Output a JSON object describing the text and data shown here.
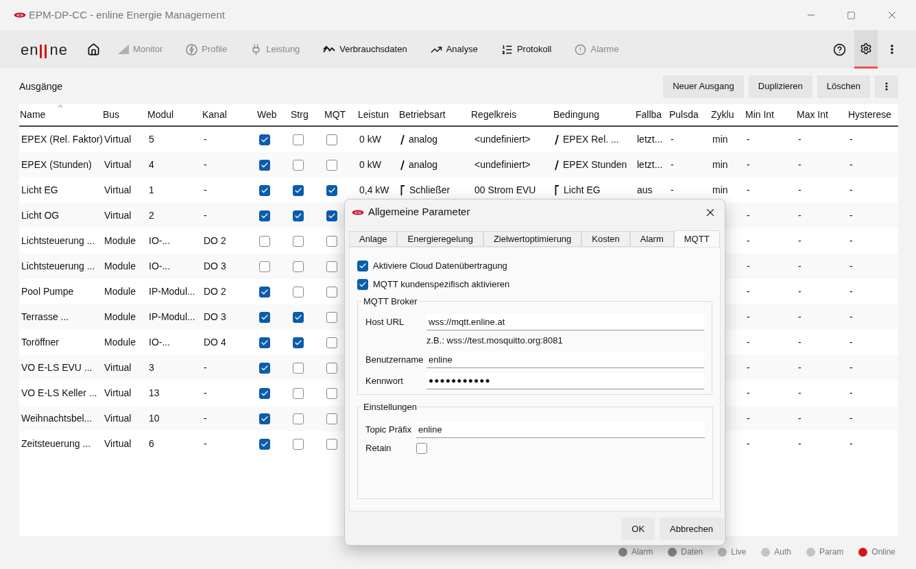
{
  "window": {
    "title": "EPM-DP-CC - enline Energie Management"
  },
  "logo": {
    "left": "en",
    "right": "ne"
  },
  "nav": [
    {
      "label": "Monitor",
      "disabled": true
    },
    {
      "label": "Profile",
      "disabled": true
    },
    {
      "label": "Leistung",
      "disabled": true
    },
    {
      "label": "Verbrauchsdaten",
      "disabled": false
    },
    {
      "label": "Analyse",
      "disabled": false
    },
    {
      "label": "Protokoll",
      "disabled": false
    },
    {
      "label": "Alarme",
      "disabled": true
    }
  ],
  "settings_active": true,
  "page": {
    "title": "Ausgänge",
    "buttons": [
      "Neuer Ausgang",
      "Duplizieren",
      "Löschen"
    ]
  },
  "table": {
    "columns": [
      {
        "label": "Name",
        "sorted": true
      },
      {
        "label": "Bus",
        "sorted": false
      },
      {
        "label": "Modul",
        "sorted": false
      },
      {
        "label": "Kanal",
        "sorted": false
      },
      {
        "label": "Web",
        "sorted": false
      },
      {
        "label": "Strg",
        "sorted": false
      },
      {
        "label": "MQT",
        "sorted": false
      },
      {
        "label": "Leistun",
        "sorted": false
      },
      {
        "label": "Betriebsart",
        "sorted": false
      },
      {
        "label": "Regelkreis",
        "sorted": false
      },
      {
        "label": "Bedingung",
        "sorted": false
      },
      {
        "label": "Fallba",
        "sorted": false
      },
      {
        "label": "Pulsda",
        "sorted": false
      },
      {
        "label": "Zyklu",
        "sorted": false
      },
      {
        "label": "Min Int",
        "sorted": false
      },
      {
        "label": "Max Int",
        "sorted": false
      },
      {
        "label": "Hysterese",
        "sorted": false
      }
    ],
    "rows": [
      {
        "name": "EPEX (Rel. Faktor)",
        "bus": "Virtual",
        "modul": "5",
        "kanal": "-",
        "web": true,
        "strg": false,
        "mqtt": false,
        "leistung": "0 kW",
        "betriebsart": {
          "kind": "analog",
          "text": "analog"
        },
        "regelkreis": "<undefiniert>",
        "bedingung": {
          "kind": "analog",
          "text": "EPEX Rel. ..."
        },
        "fallback": "letzt...",
        "pulsdauer": "-",
        "zyklus": "min",
        "min_int": "-",
        "max_int": "-",
        "hysterese": "-"
      },
      {
        "name": "EPEX (Stunden)",
        "bus": "Virtual",
        "modul": "4",
        "kanal": "-",
        "web": true,
        "strg": false,
        "mqtt": false,
        "leistung": "0 kW",
        "betriebsart": {
          "kind": "analog",
          "text": "analog"
        },
        "regelkreis": "<undefiniert>",
        "bedingung": {
          "kind": "analog",
          "text": "EPEX Stunden"
        },
        "fallback": "letzt...",
        "pulsdauer": "-",
        "zyklus": "min",
        "min_int": "-",
        "max_int": "-",
        "hysterese": "-"
      },
      {
        "name": "Licht EG",
        "bus": "Virtual",
        "modul": "1",
        "kanal": "-",
        "web": true,
        "strg": true,
        "mqtt": true,
        "leistung": "0,4 kW",
        "betriebsart": {
          "kind": "switch",
          "text": "Schließer"
        },
        "regelkreis": "00 Strom EVU",
        "bedingung": {
          "kind": "switch",
          "text": "Licht EG"
        },
        "fallback": "aus",
        "pulsdauer": "-",
        "zyklus": "min",
        "min_int": "-",
        "max_int": "-",
        "hysterese": "-"
      },
      {
        "name": "Licht OG",
        "bus": "Virtual",
        "modul": "2",
        "kanal": "-",
        "web": true,
        "strg": true,
        "mqtt": true,
        "min_int": "-",
        "max_int": "-",
        "hysterese": "-"
      },
      {
        "name": "Lichtsteuerung ...",
        "bus": "Module",
        "modul": "IO-...",
        "kanal": "DO 2",
        "web": false,
        "strg": false,
        "mqtt": false,
        "min_int": "-",
        "max_int": "-",
        "hysterese": "-"
      },
      {
        "name": "Lichtsteuerung ...",
        "bus": "Module",
        "modul": "IO-...",
        "kanal": "DO 3",
        "web": false,
        "strg": false,
        "mqtt": false,
        "min_int": "-",
        "max_int": "-",
        "hysterese": "-"
      },
      {
        "name": "Pool Pumpe",
        "bus": "Module",
        "modul": "IP-Modul...",
        "kanal": "DO 2",
        "web": true,
        "strg": false,
        "mqtt": false,
        "min_int": "-",
        "max_int": "-",
        "hysterese": "-"
      },
      {
        "name": "Terrasse ...",
        "bus": "Module",
        "modul": "IP-Modul...",
        "kanal": "DO 3",
        "web": true,
        "strg": true,
        "mqtt": false,
        "min_int": "-",
        "max_int": "-",
        "hysterese": "-"
      },
      {
        "name": "Toröffner",
        "bus": "Module",
        "modul": "IO-...",
        "kanal": "DO 4",
        "web": true,
        "strg": true,
        "mqtt": false,
        "min_int": "-",
        "max_int": "-",
        "hysterese": "-"
      },
      {
        "name": "VO E-LS EVU ...",
        "bus": "Virtual",
        "modul": "3",
        "kanal": "-",
        "web": true,
        "strg": false,
        "mqtt": false,
        "min_int": "-",
        "max_int": "-",
        "hysterese": "-"
      },
      {
        "name": "VO E-LS Keller ...",
        "bus": "Virtual",
        "modul": "13",
        "kanal": "-",
        "web": true,
        "strg": false,
        "mqtt": false,
        "min_int": "-",
        "max_int": "-",
        "hysterese": "-"
      },
      {
        "name": "Weihnachtsbel...",
        "bus": "Virtual",
        "modul": "10",
        "kanal": "-",
        "web": true,
        "strg": false,
        "mqtt": false,
        "min_int": "-",
        "max_int": "-",
        "hysterese": "-"
      },
      {
        "name": "Zeitsteuerung ...",
        "bus": "Virtual",
        "modul": "6",
        "kanal": "-",
        "web": true,
        "strg": false,
        "mqtt": false,
        "min_int": "-",
        "max_int": "-",
        "hysterese": "-"
      }
    ]
  },
  "dialog": {
    "title": "Allgemeine Parameter",
    "tabs": [
      {
        "label": "Anlage",
        "selected": false
      },
      {
        "label": "Energieregelung",
        "selected": false
      },
      {
        "label": "Zielwertoptimierung",
        "selected": false
      },
      {
        "label": "Kosten",
        "selected": false
      },
      {
        "label": "Alarm",
        "selected": false
      },
      {
        "label": "MQTT",
        "selected": true
      }
    ],
    "options": [
      {
        "label": "Aktiviere Cloud Datenübertragung",
        "checked": true
      },
      {
        "label": "MQTT kundenspezifisch aktivieren",
        "checked": true
      }
    ],
    "broker": {
      "title": "MQTT Broker",
      "host_label": "Host URL",
      "host_value": "wss://mqtt.enline.at",
      "hint": "z.B.: wss://test.mosquitto.org:8081",
      "user_label": "Benutzername",
      "user_value": "enline",
      "password_label": "Kennwort",
      "password_value": "●●●●●●●●●●●"
    },
    "settings": {
      "title": "Einstellungen",
      "prefix_label": "Topic Präfix",
      "prefix_value": "enline",
      "retain_label": "Retain",
      "retain": false
    },
    "buttons": [
      "OK",
      "Abbrechen"
    ]
  },
  "status_bar": [
    {
      "label": "Alarm",
      "color": "#8a8a8a"
    },
    {
      "label": "Daten",
      "color": "#8a8a8a"
    },
    {
      "label": "Live",
      "color": "#b5b5b5"
    },
    {
      "label": "Auth",
      "color": "#c4c4c4"
    },
    {
      "label": "Param",
      "color": "#c4c4c4"
    },
    {
      "label": "Online",
      "color": "#d7141a"
    }
  ]
}
